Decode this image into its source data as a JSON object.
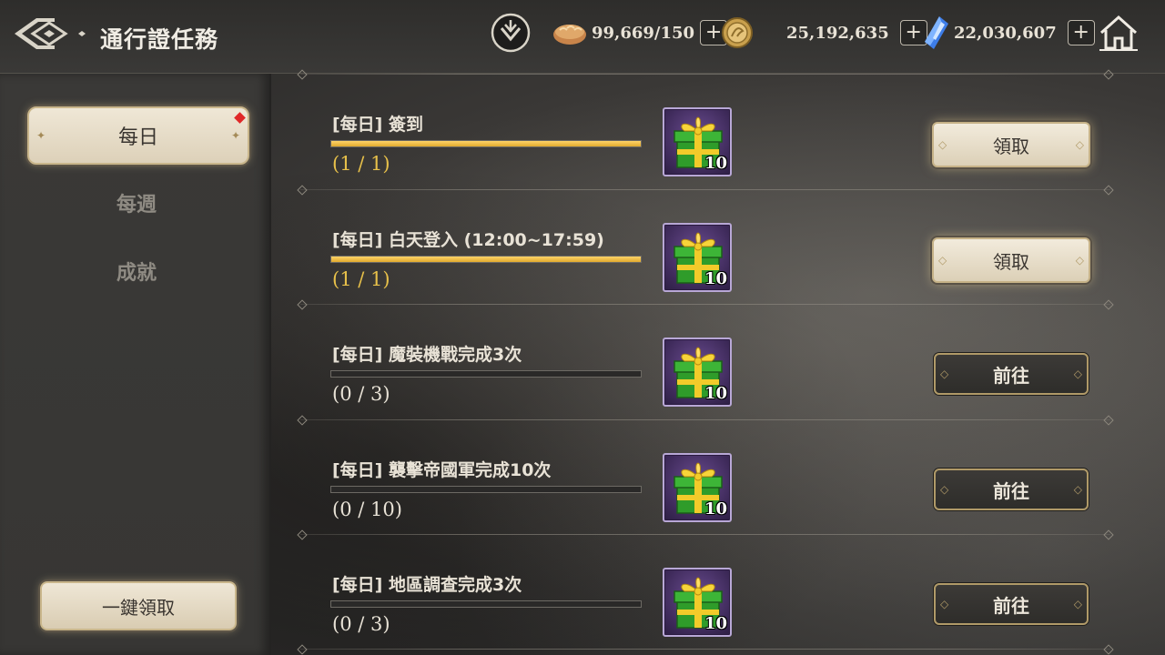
{
  "header": {
    "title": "通行證任務",
    "resources": {
      "stamina": "99,669/150",
      "coin": "25,192,635",
      "crystal": "22,030,607"
    },
    "icons": {
      "back": "back-icon",
      "download": "download-icon",
      "stamina": "bread-icon",
      "coin": "coin-icon",
      "crystal": "crystal-icon",
      "home": "home-icon",
      "plus": "+"
    }
  },
  "sidebar": {
    "tabs": [
      {
        "label": "每日",
        "active": true,
        "badge": true
      },
      {
        "label": "每週",
        "active": false
      },
      {
        "label": "成就",
        "active": false
      }
    ],
    "claim_all_label": "一鍵領取"
  },
  "quests": [
    {
      "title": "[每日] 簽到",
      "progress": "(1 / 1)",
      "fraction": 1.0,
      "reward_qty": "10",
      "action": "領取",
      "state": "claim"
    },
    {
      "title": "[每日] 白天登入 (12:00~17:59)",
      "progress": "(1 / 1)",
      "fraction": 1.0,
      "reward_qty": "10",
      "action": "領取",
      "state": "claim"
    },
    {
      "title": "[每日] 魔裝機戰完成3次",
      "progress": "(0 / 3)",
      "fraction": 0.0,
      "reward_qty": "10",
      "action": "前往",
      "state": "go"
    },
    {
      "title": "[每日] 襲擊帝國軍完成10次",
      "progress": "(0 / 10)",
      "fraction": 0.0,
      "reward_qty": "10",
      "action": "前往",
      "state": "go"
    },
    {
      "title": "[每日] 地區調查完成3次",
      "progress": "(0 / 3)",
      "fraction": 0.0,
      "reward_qty": "10",
      "action": "前往",
      "state": "go"
    }
  ],
  "colors": {
    "accent_gold": "#e8c14a",
    "reward_frame": "#b8a7d6",
    "alert_red": "#e02828"
  }
}
